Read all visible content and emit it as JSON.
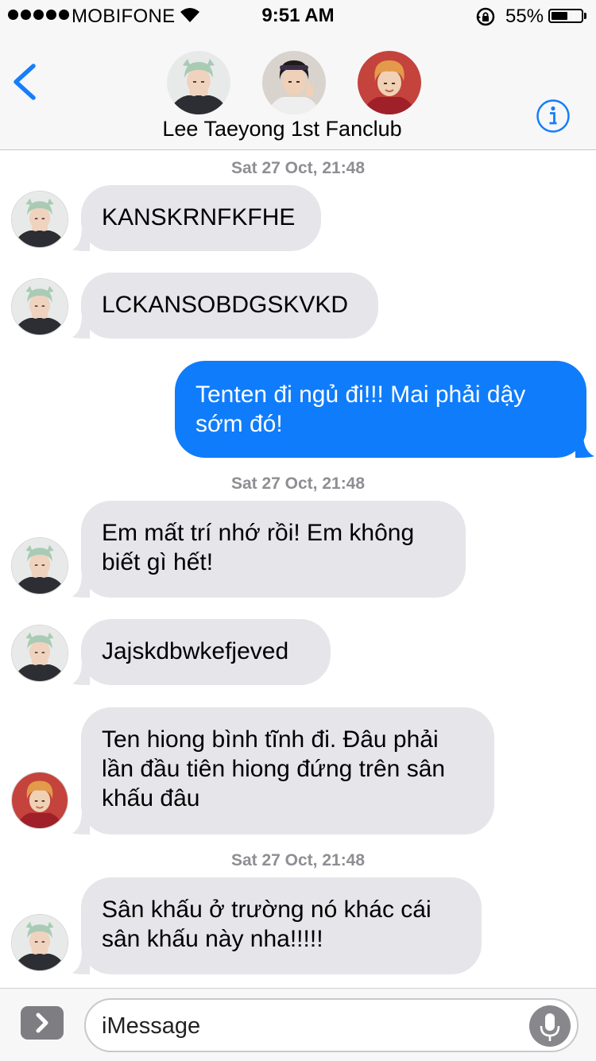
{
  "status_bar": {
    "carrier": "MOBIFONE",
    "time": "9:51 AM",
    "battery_percent": "55%",
    "battery_level": 0.55,
    "icons": [
      "signal-dots-icon",
      "wifi-icon",
      "rotation-lock-icon",
      "battery-icon"
    ]
  },
  "header": {
    "group_name": "Lee Taeyong 1st Fanclub",
    "back_icon": "chevron-left-icon",
    "info_icon": "info-icon",
    "accent_color": "#157efb"
  },
  "messages": [
    {
      "timestamp": "Sat 27 Oct, 21:48"
    },
    {
      "text": "KANSKRNFKFHE",
      "direction": "incoming",
      "sender_avatar": "green-hair-avatar"
    },
    {
      "text": "LCKANSOBDGSKVKD",
      "direction": "incoming",
      "sender_avatar": "green-hair-avatar"
    },
    {
      "text": "Tenten đi ngủ đi!!! Mai phải dậy sớm đó!",
      "direction": "outgoing"
    },
    {
      "timestamp": "Sat 27 Oct, 21:48"
    },
    {
      "text": "Em mất trí nhớ rồi! Em không biết gì hết!",
      "direction": "incoming",
      "sender_avatar": "green-hair-avatar"
    },
    {
      "text": "Jajskdbwkefjeved",
      "direction": "incoming",
      "sender_avatar": "green-hair-avatar"
    },
    {
      "text": "Ten hiong bình tĩnh đi. Đâu phải lần đầu tiên hiong đứng trên sân khấu đâu",
      "direction": "incoming",
      "sender_avatar": "orange-hair-avatar"
    },
    {
      "timestamp": "Sat 27 Oct, 21:48"
    },
    {
      "text": "Sân khấu ở trường nó khác cái sân khấu này nha!!!!!",
      "direction": "incoming",
      "sender_avatar": "green-hair-avatar"
    }
  ],
  "input": {
    "placeholder": "iMessage",
    "apps_icon": "chevron-right-icon",
    "mic_icon": "microphone-icon"
  },
  "colors": {
    "incoming_bubble": "#e5e5ea",
    "outgoing_bubble": "#0f7cfb",
    "timestamp": "#8e8e93"
  }
}
